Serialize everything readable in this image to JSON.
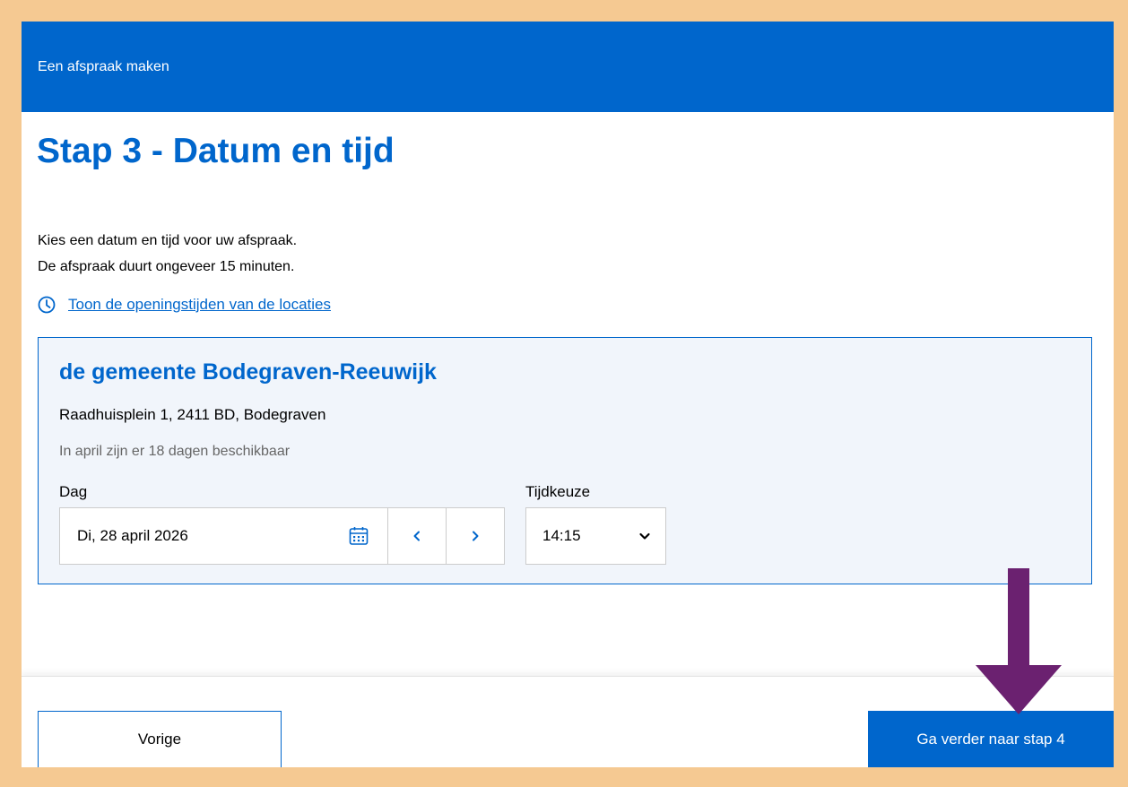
{
  "header": {
    "title": "Een afspraak maken"
  },
  "page": {
    "title": "Stap 3 - Datum en tijd",
    "intro_line1": "Kies een datum en tijd voor uw afspraak.",
    "intro_line2": "De afspraak duurt ongeveer 15 minuten.",
    "hours_link": "Toon de openingstijden van de locaties"
  },
  "location": {
    "name": "de gemeente Bodegraven-Reeuwijk",
    "address": "Raadhuisplein 1, 2411 BD, Bodegraven",
    "availability": "In april zijn er 18 dagen beschikbaar",
    "day_label": "Dag",
    "day_value": "Di, 28 april 2026",
    "time_label": "Tijdkeuze",
    "time_value": "14:15"
  },
  "footer": {
    "prev_label": "Vorige",
    "next_label": "Ga verder naar stap 4"
  },
  "icons": {
    "clock": "clock-icon",
    "calendar": "calendar-icon",
    "prev": "chevron-left-icon",
    "next": "chevron-right-icon",
    "dropdown": "chevron-down-icon",
    "annotation": "arrow-down-icon"
  },
  "colors": {
    "brand": "#0066cc",
    "frame": "#f5c992",
    "panel_bg": "#f1f5fb",
    "annotation_arrow": "#6b2170"
  }
}
